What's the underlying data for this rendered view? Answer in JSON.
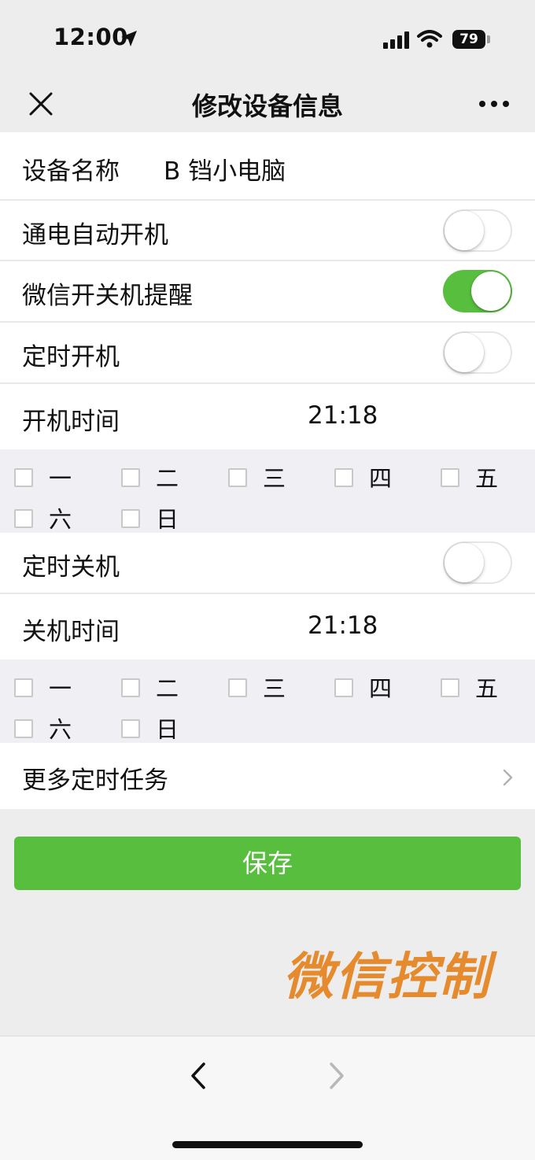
{
  "status": {
    "time": "12:00",
    "battery": "79"
  },
  "nav": {
    "title": "修改设备信息"
  },
  "device_name": {
    "label": "设备名称",
    "value": "B 铛小电脑"
  },
  "auto_power_on": {
    "label": "通电自动开机",
    "enabled": false
  },
  "wechat_notify": {
    "label": "微信开关机提醒",
    "enabled": true
  },
  "timed_on": {
    "label": "定时开机",
    "enabled": false,
    "time_label": "开机时间",
    "time": "21:18"
  },
  "timed_off": {
    "label": "定时关机",
    "enabled": false,
    "time_label": "关机时间",
    "time": "21:18"
  },
  "weekdays": [
    "一",
    "二",
    "三",
    "四",
    "五",
    "六",
    "日"
  ],
  "more_tasks": {
    "label": "更多定时任务"
  },
  "save_label": "保存",
  "watermark": "微信控制",
  "colors": {
    "accent_green": "#58be3e",
    "watermark": "#e68a2e",
    "panel_bg": "#efeff4"
  },
  "icons": [
    "close-icon",
    "more-icon",
    "location-arrow-icon",
    "signal-icon",
    "wifi-icon",
    "chevron-right-icon",
    "back-arrow-icon",
    "forward-arrow-icon"
  ]
}
